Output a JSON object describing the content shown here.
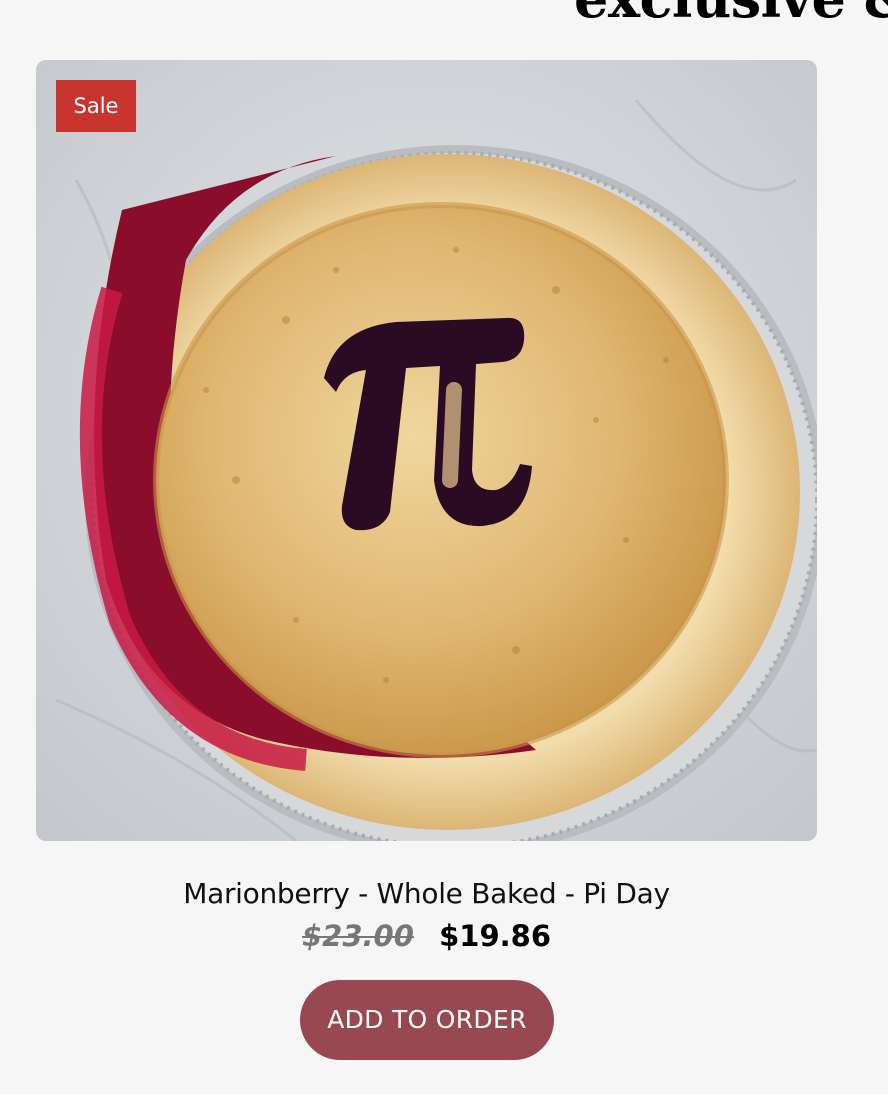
{
  "header": {
    "heading_partial": "exclusive &"
  },
  "product": {
    "badge": "Sale",
    "title": "Marionberry - Whole Baked - Pi Day",
    "original_price": "$23.00",
    "sale_price": "$19.86",
    "image_subject": "pie-with-pi-symbol-image",
    "add_button_label": "ADD TO ORDER"
  },
  "colors": {
    "background": "#f6f6f6",
    "sale_badge": "#c8352e",
    "button": "#984850",
    "crust": "#e3bd7a",
    "filling": "#7a0f2a"
  }
}
